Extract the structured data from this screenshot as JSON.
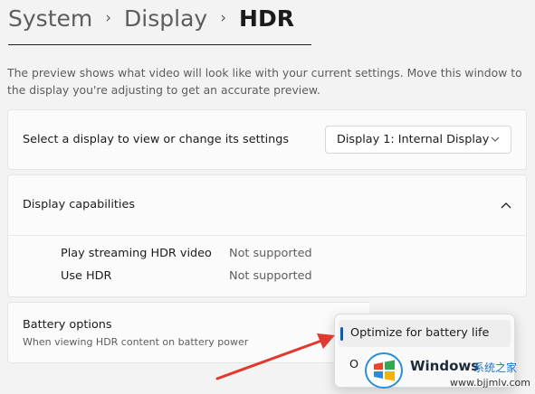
{
  "breadcrumb": {
    "items": [
      "System",
      "Display"
    ],
    "current": "HDR",
    "separator": "›"
  },
  "description": "The preview shows what video will look like with your current settings. Move this window to the display you're adjusting to get an accurate preview.",
  "select_display": {
    "label": "Select a display to view or change its settings",
    "dropdown_value": "Display 1: Internal Display"
  },
  "capabilities": {
    "title": "Display capabilities",
    "items": [
      {
        "name": "Play streaming HDR video",
        "value": "Not supported"
      },
      {
        "name": "Use HDR",
        "value": "Not supported"
      }
    ]
  },
  "battery": {
    "title": "Battery options",
    "subtitle": "When viewing HDR content on battery power",
    "options": [
      "Optimize for battery life"
    ],
    "selected": "Optimize for battery life",
    "second_option_partial": "O"
  },
  "annotation": {
    "arrow_color": "#e03a2f"
  },
  "watermark": {
    "title": "Windows",
    "cn_text": "系统之家",
    "url": "www.bjjmlv.com"
  },
  "colors": {
    "accent": "#005fb8",
    "background": "#f3f3f3",
    "card": "#fbfbfb"
  }
}
